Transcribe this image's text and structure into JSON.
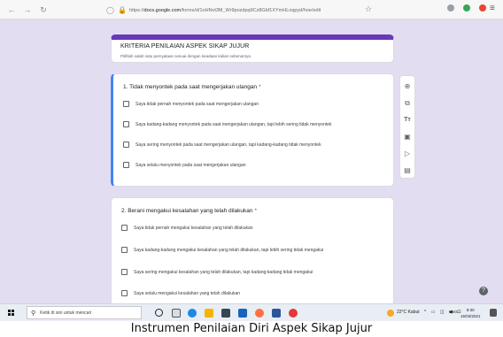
{
  "browser": {
    "back_icon": "arrow-left-icon",
    "forward_icon": "arrow-right-icon",
    "reload_icon": "reload-icon",
    "url_prefix": "https://",
    "url_host": "docs.google.com",
    "url_path": "/forms/d/1oHNvt3M_Wr9pozdpq9Cz8Gbf1XYmHLoqpyd/hoe/edit"
  },
  "form": {
    "title": "KRITERIA PENILAIAN ASPEK SIKAP JUJUR",
    "description": "Pilihlah salah satu pernyataan sesuai dengan keadaan kalian sebenarnya",
    "questions": [
      {
        "title": "1.  Tidak menyontek pada saat mengerjakan ulangan",
        "required_mark": "*",
        "options": [
          "Saya  tidak pernah  menyontek pada saat mengerjakan ulangan",
          "Saya kadang-kadang menyontek pada saat mengerjakan ulangan, tapi lebih sering tidak menyontek",
          "Saya  sering menyontek pada saat mengerjakan ulangan, tapi kadang-kadang tidak menyontek",
          "Saya  selalu menyontek pada saat mengerjakan ulangan"
        ]
      },
      {
        "title": "2.  Berani mengakui kesalahan yang telah dilakukan",
        "required_mark": "*",
        "options": [
          "Saya  tidak pernah  mengakui kesalahan yang telah dilakukan",
          "Saya kadang-kadang mengakui kesalahan yang telah dilakukan, tapi lebih sering tidak mengakui",
          "Saya  sering mengakui kesalahan yang telah dilakukan, tapi kadang-kadang tidak mengakui",
          "Saya  selalu mengakui kesalahan yang telah dilakukan"
        ]
      }
    ]
  },
  "toolbar": {
    "tools": [
      "add-question-icon",
      "import-questions-icon",
      "add-title-icon",
      "add-image-icon",
      "add-video-icon",
      "add-section-icon"
    ]
  },
  "taskbar": {
    "search_placeholder": "Ketik di sini untuk mencari",
    "weather": "22°C  Kabut",
    "lang": "ENG",
    "time": "8:30",
    "date": "15/03/2021"
  },
  "caption": "Instrumen Penilaian Diri Aspek Sikap Jujur",
  "colors": {
    "accent": "#673ab7",
    "page_bg": "#e3ddf2",
    "active_question": "#4285f4",
    "required": "#d93025"
  }
}
